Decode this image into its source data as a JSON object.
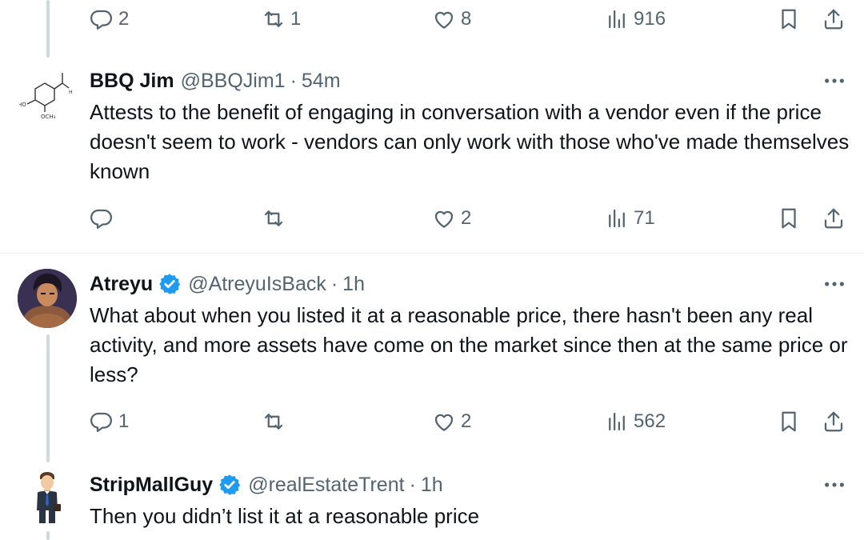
{
  "top_actions": {
    "replies": "2",
    "reposts": "1",
    "likes": "8",
    "views": "916"
  },
  "posts": [
    {
      "name": "BBQ Jim",
      "handle": "@BBQJim1",
      "time": "54m",
      "verified": false,
      "text": "Attests to the benefit of engaging in conversation with a vendor even if the price doesn't seem to work - vendors can only work with those who've made themselves known",
      "actions": {
        "replies": "",
        "reposts": "",
        "likes": "2",
        "views": "71"
      }
    },
    {
      "name": "Atreyu",
      "handle": "@AtreyuIsBack",
      "time": "1h",
      "verified": true,
      "text": "What about when you listed it at a reasonable price, there hasn't been any real activity, and more assets have come on the market since then at the same price or less?",
      "actions": {
        "replies": "1",
        "reposts": "",
        "likes": "2",
        "views": "562"
      }
    },
    {
      "name": "StripMallGuy",
      "handle": "@realEstateTrent",
      "time": "1h",
      "verified": true,
      "text": "Then you didn’t list it at a reasonable price"
    }
  ],
  "separator": "·",
  "avatar_texts": {
    "bbq_oh": "HO",
    "bbq_och3": "OCH₃",
    "bbq_h": "H"
  },
  "colors": {
    "text": "#0f1419",
    "secondary": "#536471",
    "verified": "#1d9bf0",
    "thread_line": "#cfd9de"
  },
  "icons": [
    "reply-icon",
    "repost-icon",
    "like-icon",
    "views-icon",
    "bookmark-icon",
    "share-icon",
    "more-icon",
    "verified-badge-icon"
  ]
}
